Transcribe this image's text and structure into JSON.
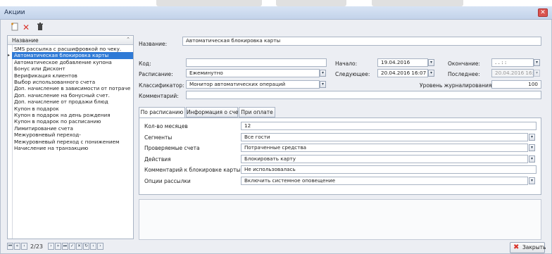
{
  "window": {
    "title": "Акции",
    "close_glyph": "✕"
  },
  "toolbar": {
    "add_icon": "add-icon",
    "delete_icon": "delete-icon",
    "trash_icon": "trash-icon"
  },
  "list": {
    "header": "Название",
    "sort_glyph": "⌃",
    "items": [
      "SMS рассылка с расшифровкой по чеку.",
      "Автоматическая блокировка карты",
      "Автоматическое добавление купона",
      "Бонус или Дисконт",
      "Верификация клиентов",
      "Выбор использованного счета",
      "Доп. начисление в зависимости от потраче",
      "Доп. начисление на бонусный счет.",
      "Доп. начисление от продажи блюд",
      "Купон в подарок",
      "Купон в подарок на день рождения",
      "Купон в подарок по расписанию",
      "Лимитирование счета",
      "Межуровневый переход-",
      "Межуровневый переход с понижением",
      "Начисление на транзакцию"
    ],
    "selected_index": 1
  },
  "pager": {
    "page_text": "2/23",
    "first": "⏮",
    "prev2": "«",
    "prev": "‹",
    "next": "›",
    "next2": "»",
    "last": "⏭",
    "confirm": "✓",
    "cancel": "✕",
    "refresh": "↻",
    "scroll_left": "‹",
    "scroll_right": "›"
  },
  "form": {
    "name_label": "Название:",
    "name_value": "Автоматическая блокировка карты",
    "code_label": "Код:",
    "code_value": "",
    "schedule_label": "Расписание:",
    "schedule_value": "Ежеминутно",
    "classifier_label": "Классификатор:",
    "classifier_value": "Монитор автоматических операций",
    "comment_label": "Комментарий:",
    "comment_value": "",
    "start_label": "Начало:",
    "start_value": "19.04.2016",
    "next_label": "Следующее:",
    "next_value": "20.04.2016 16:07",
    "end_label": "Окончание:",
    "end_value": ". .   : :",
    "last_label": "Последнее:",
    "last_value": "20.04.2016 16:06",
    "log_level_label": "Уровень журналирования:",
    "log_level_value": "100",
    "dropdown_glyph": "▾"
  },
  "tabs": [
    "По расписанию",
    "Информация о счете",
    "При оплате"
  ],
  "params": [
    {
      "label": "Кол-во месяцев",
      "value": "12",
      "dropdown": false
    },
    {
      "label": "Сегменты",
      "value": "Все гости",
      "dropdown": true
    },
    {
      "label": "Проверяемые счета",
      "value": "Потраченные средства",
      "dropdown": true
    },
    {
      "label": "Действия",
      "value": "Блокировать карту",
      "dropdown": true
    },
    {
      "label": "Комментарий к блокировке карты",
      "value": "Не использовалась",
      "dropdown": false
    },
    {
      "label": "Опции рассылки",
      "value": "Включить системное оповещение",
      "dropdown": true
    }
  ],
  "close_button": {
    "label": "Закрыть",
    "glyph": "✖"
  },
  "colors": {
    "selection": "#2f7ad6",
    "titlebar": "#c3d3ea",
    "close_red": "#d9534f"
  }
}
